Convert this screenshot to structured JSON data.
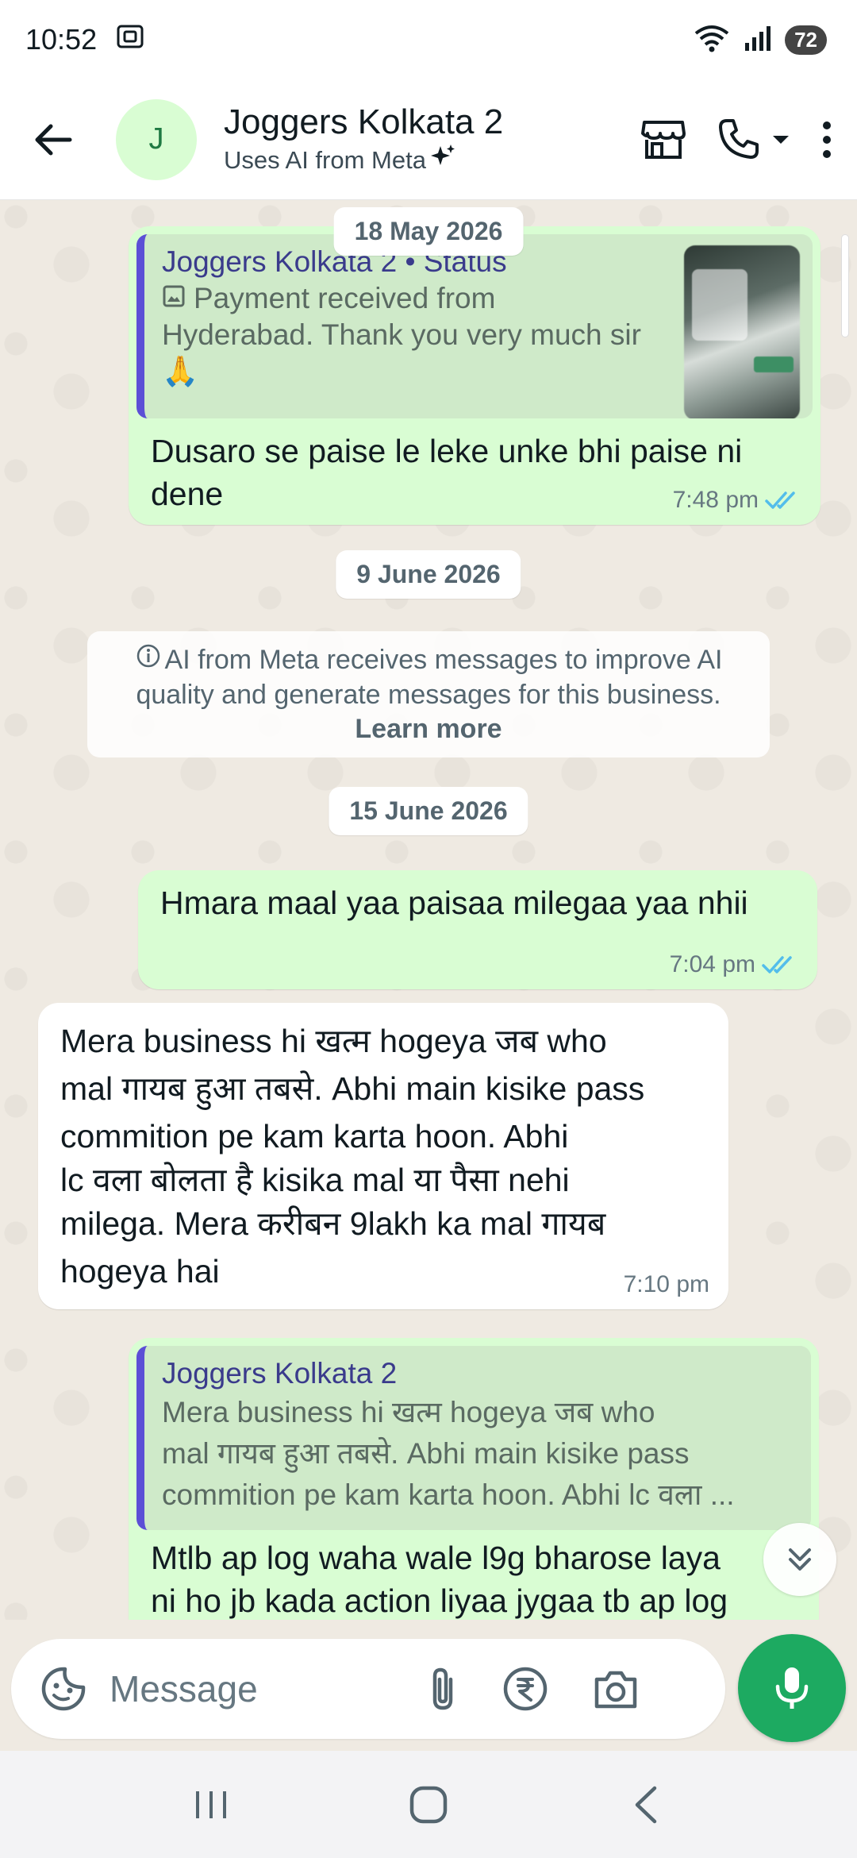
{
  "status_bar": {
    "time": "10:52",
    "battery": "72"
  },
  "header": {
    "avatar_letter": "J",
    "title": "Joggers Kolkata 2",
    "subtitle": "Uses AI from Meta"
  },
  "chat": {
    "date_1": "18 May 2026",
    "msg1": {
      "quote_name": "Joggers Kolkata 2 • Status",
      "quote_text_1": "Payment received from",
      "quote_text_2": "Hyderabad. Thank you very much sir",
      "quote_text_3": "🙏",
      "text_1": "Dusaro se paise le leke unke bhi paise ni",
      "text_2": "dene",
      "time": "7:48 pm"
    },
    "date_2": "9 June 2026",
    "info": {
      "line_1": "AI from Meta receives messages to improve AI",
      "line_2": "quality and generate messages for this business.",
      "learn_more": "Learn more"
    },
    "date_3": "15 June 2026",
    "msg2": {
      "text": "Hmara maal yaa paisaa milegaa yaa nhii",
      "time": "7:04 pm"
    },
    "msg3": {
      "line_1": "Mera business hi खत्म hogeya जब who",
      "line_2": "mal गायब हुआ तबसे. Abhi main kisike pass",
      "line_3": "commition pe kam karta hoon. Abhi",
      "line_4": "lc वला बोलता है kisika mal या पैसा nehi",
      "line_5": "milega. Mera करीबन 9lakh ka mal गायब",
      "line_6": "hogeya hai",
      "time": "7:10 pm"
    },
    "msg4": {
      "quote_name": "Joggers Kolkata 2",
      "quote_line_1": "Mera business hi खत्म hogeya जब who",
      "quote_line_2": "mal गायब हुआ तबसे. Abhi main kisike pass",
      "quote_line_3": "commition pe kam karta hoon. Abhi lc वला ...",
      "text_1": "Mtlb ap log waha wale l9g bharose laya",
      "text_2": "ni ho jb kada action liyaa jygaa tb ap log"
    }
  },
  "input": {
    "placeholder": "Message"
  },
  "colors": {
    "outgoing_bubble": "#d9fdd3",
    "incoming_bubble": "#ffffff",
    "accent_green": "#1daa61",
    "read_tick_blue": "#53bdeb",
    "quote_bar": "#5c4fd6"
  }
}
